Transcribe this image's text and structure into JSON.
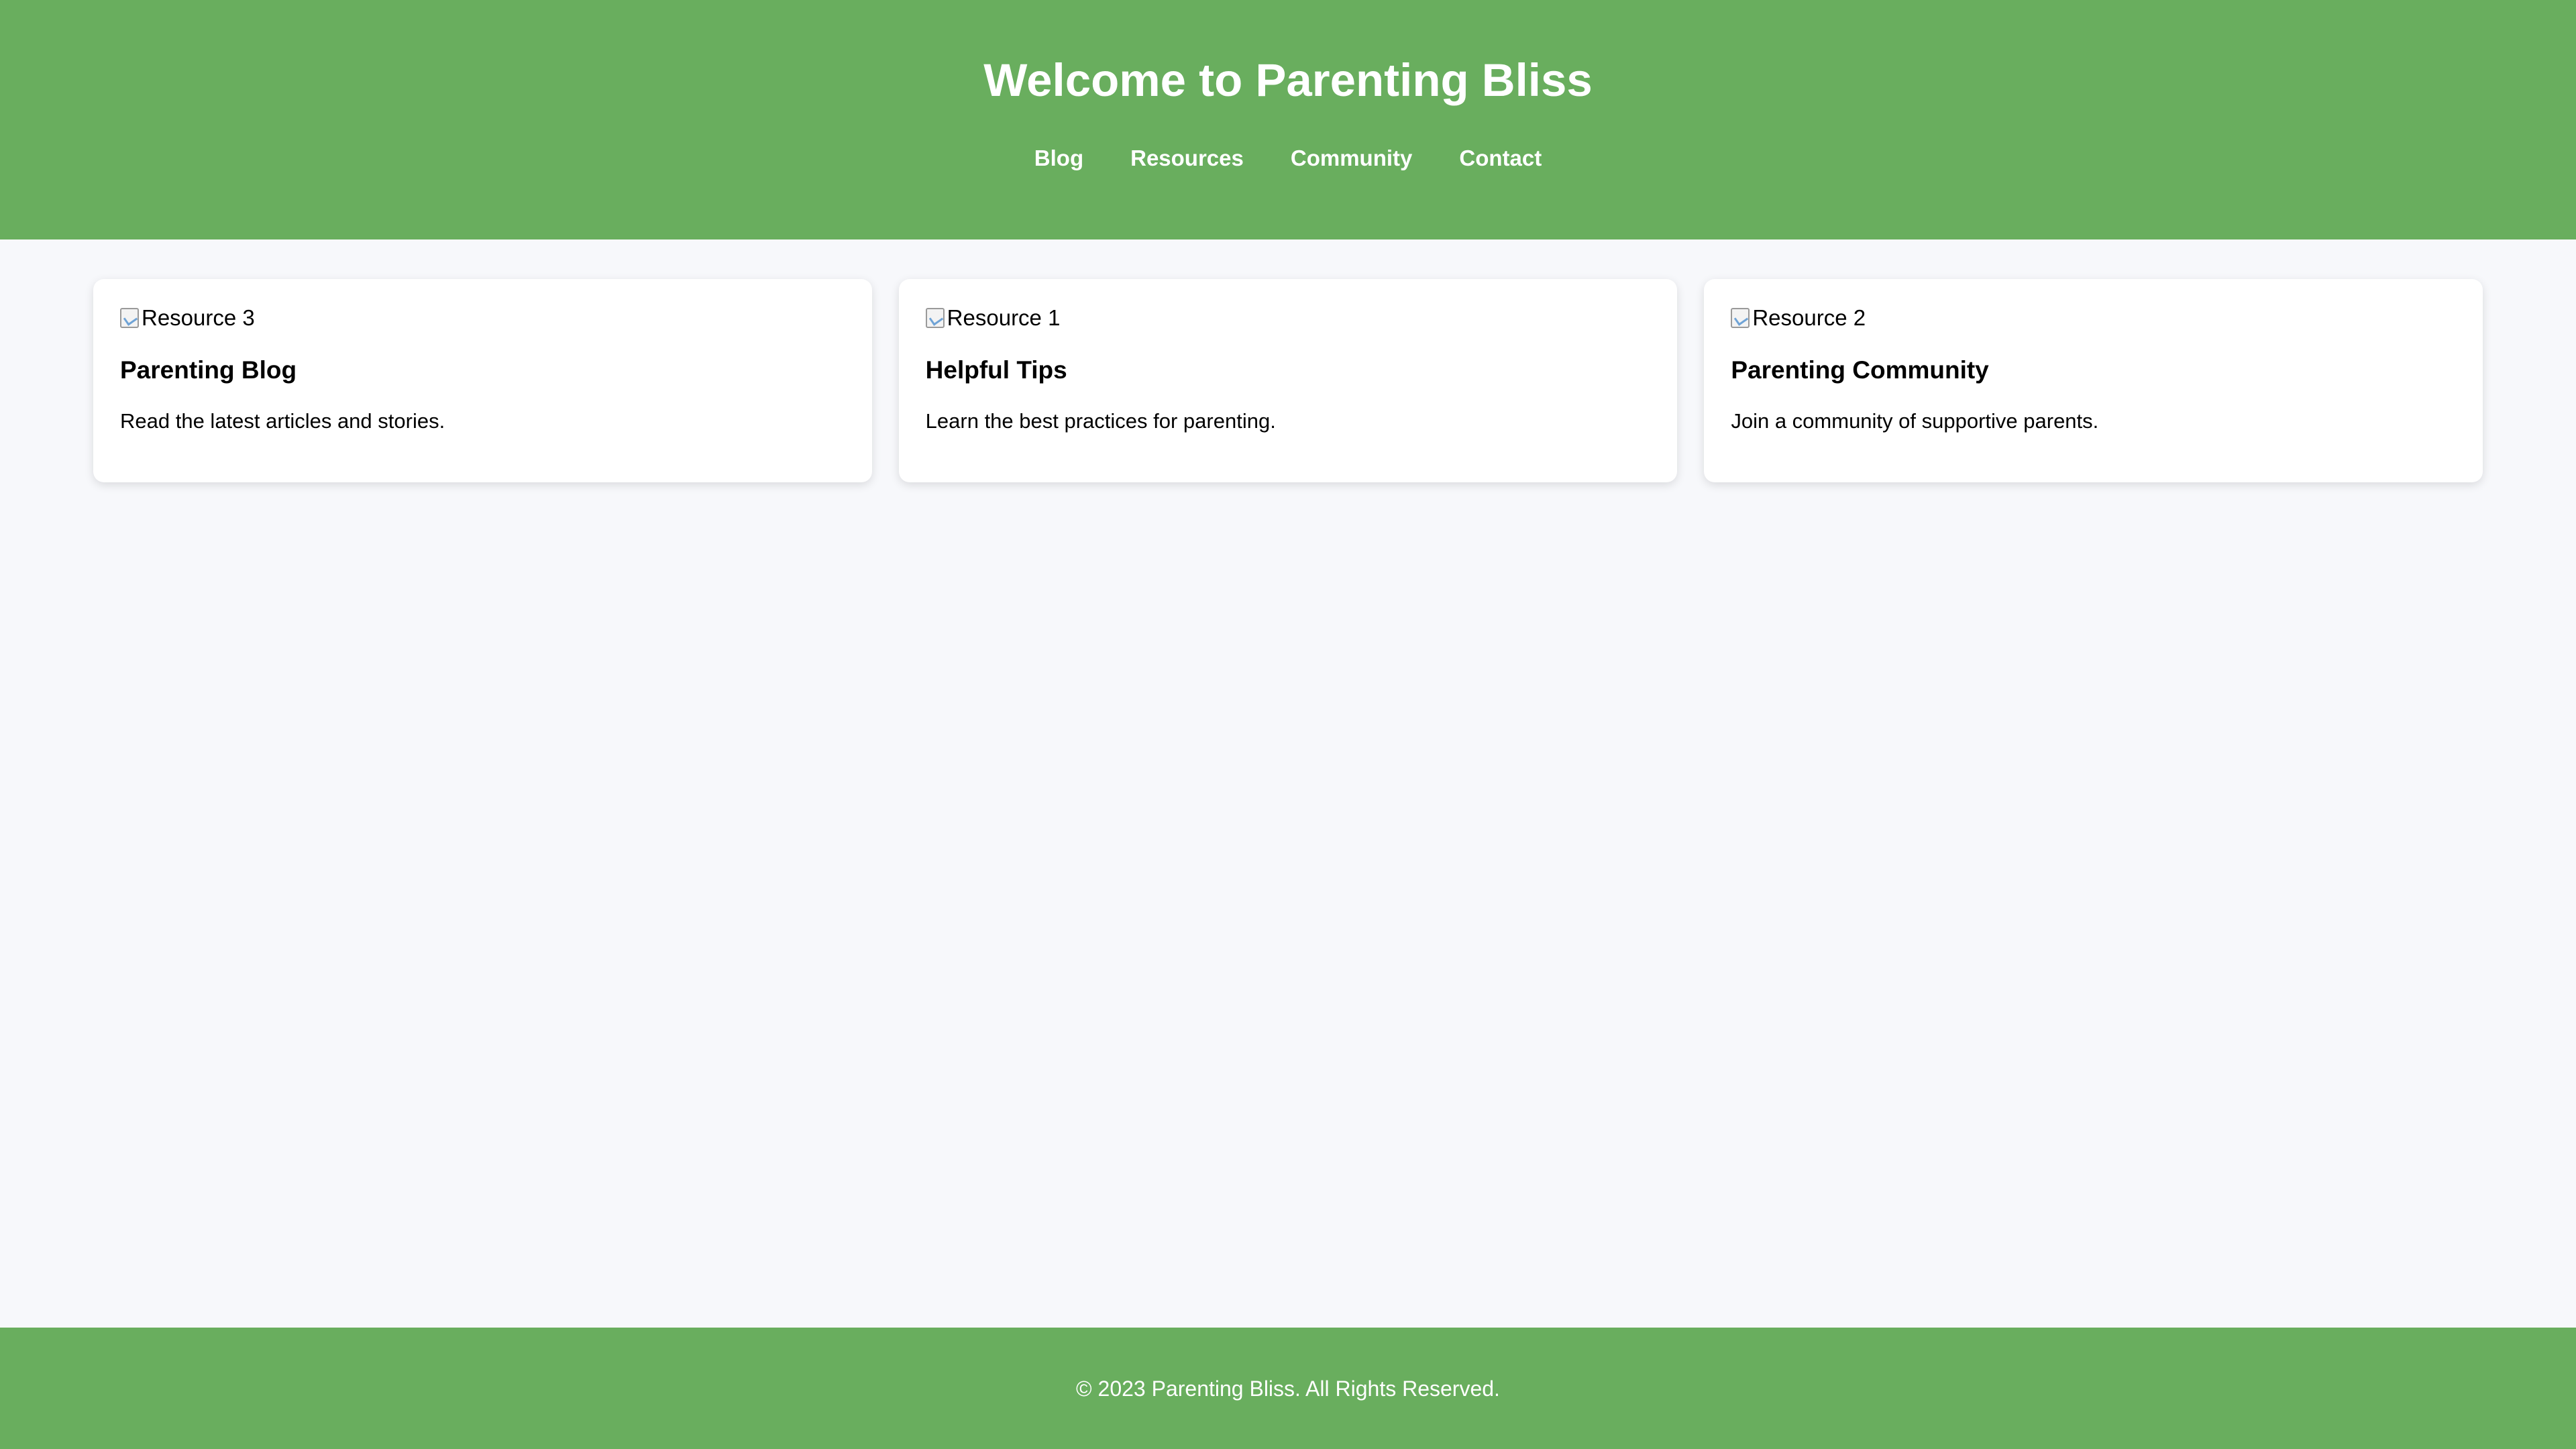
{
  "colors": {
    "header_background": "#69ae5e",
    "page_background": "#f7f8fb",
    "card_background": "#ffffff",
    "header_text": "#ffffff"
  },
  "header": {
    "title": "Welcome to Parenting Bliss",
    "nav": [
      {
        "label": "Blog"
      },
      {
        "label": "Resources"
      },
      {
        "label": "Community"
      },
      {
        "label": "Contact"
      }
    ]
  },
  "cards": [
    {
      "image_alt": "Resource 3",
      "image_icon": "broken-image-icon",
      "title": "Parenting Blog",
      "text": "Read the latest articles and stories."
    },
    {
      "image_alt": "Resource 1",
      "image_icon": "broken-image-icon",
      "title": "Helpful Tips",
      "text": "Learn the best practices for parenting."
    },
    {
      "image_alt": "Resource 2",
      "image_icon": "broken-image-icon",
      "title": "Parenting Community",
      "text": "Join a community of supportive parents."
    }
  ],
  "footer": {
    "text": "© 2023 Parenting Bliss. All Rights Reserved."
  }
}
